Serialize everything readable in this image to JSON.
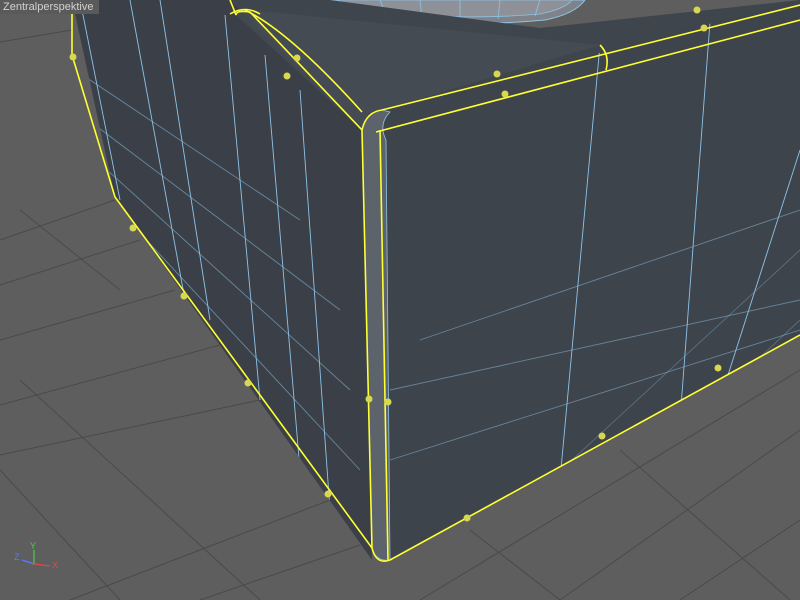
{
  "viewport": {
    "label": "Zentralperspektive",
    "background_color": "#5e5e5e",
    "floor_grid_color": "#484848",
    "mesh_fill_color": "#3d434b",
    "wire_color": "#8dc3e8",
    "selection_color": "#ffff33",
    "point_color": "#d8d850"
  },
  "axis_gizmo": {
    "x_label": "X",
    "y_label": "Y",
    "z_label": "Z",
    "x_color": "#e04848",
    "y_color": "#48d048",
    "z_color": "#5a7aff"
  }
}
